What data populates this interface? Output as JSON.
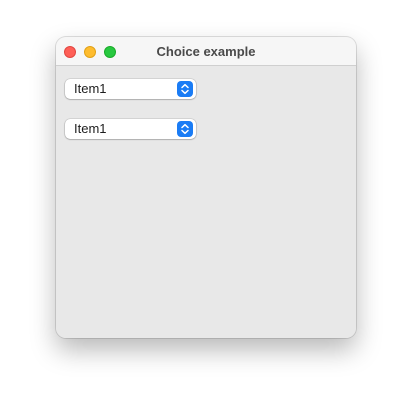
{
  "window": {
    "title": "Choice example"
  },
  "choices": [
    {
      "selected": "Item1",
      "icon": "chevron-up-down-icon"
    },
    {
      "selected": "Item1",
      "icon": "chevron-up-down-icon"
    }
  ],
  "colors": {
    "accent": "#1a7cf5",
    "close": "#fe5f57",
    "minimize": "#febc2e",
    "zoom": "#28c840"
  }
}
